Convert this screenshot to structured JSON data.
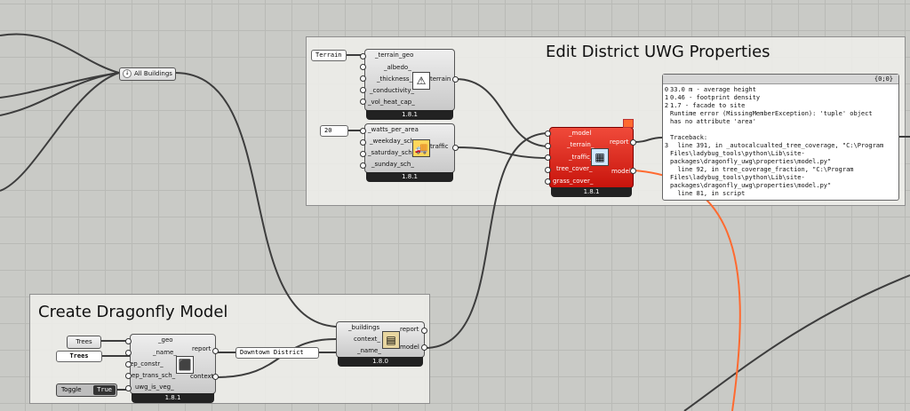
{
  "groups": {
    "uwg_title": "Edit District UWG Properties",
    "model_title": "Create Dragonfly Model"
  },
  "params": {
    "all_buildings": "All Buildings",
    "trees_param": "Trees"
  },
  "inputs": {
    "terrain_panel": "Terrain",
    "watts_panel": "20",
    "trees_panel": "Trees",
    "district_panel": "Downtown District",
    "toggle_label": "Toggle",
    "toggle_value": "True"
  },
  "terrain_comp": {
    "inputs": [
      "_terrain_geo",
      "_albedo_",
      "_thickness_",
      "_conductivity_",
      "_vol_heat_cap_"
    ],
    "output": "terrain",
    "version": "1.8.1"
  },
  "traffic_comp": {
    "inputs": [
      "_watts_per_area",
      "_weekday_sch_",
      "_saturday_sch_",
      "_sunday_sch_"
    ],
    "output": "traffic",
    "version": "1.8.1"
  },
  "uwg_comp": {
    "inputs": [
      "_model",
      "_terrain_",
      "_traffic_",
      "tree_cover_",
      "grass_cover_"
    ],
    "outputs": [
      "report",
      "model"
    ],
    "version": "1.8.1"
  },
  "building_comp": {
    "inputs": [
      "_geo",
      "_name_",
      "ep_constr_",
      "ep_trans_sch_",
      "uwg_is_veg_"
    ],
    "outputs": [
      "report",
      "context"
    ],
    "version": "1.8.1"
  },
  "model_comp": {
    "inputs": [
      "_buildings",
      "context_",
      "_name_"
    ],
    "outputs": [
      "report",
      "model"
    ],
    "version": "1.8.0"
  },
  "report_panel": {
    "header": "{0;0}",
    "rows": [
      {
        "idx": "0",
        "text": "33.0 m - average height"
      },
      {
        "idx": "1",
        "text": "0.46 - footprint density"
      },
      {
        "idx": "2",
        "text": "1.7 - facade to site"
      },
      {
        "idx": "3",
        "text": "Runtime error (MissingMemberException): 'tuple' object\nhas no attribute 'area'\n\nTraceback:\n  line 391, in _autocalcualted_tree_coverage, \"C:\\Program\nFiles\\ladybug_tools\\python\\Lib\\site-\npackages\\dragonfly_uwg\\properties\\model.py\"\n  line 92, in tree_coverage_fraction, \"C:\\Program\nFiles\\ladybug_tools\\python\\Lib\\site-\npackages\\dragonfly_uwg\\properties\\model.py\"\n  line 81, in script"
      }
    ]
  },
  "colors": {
    "canvas": "#c9cac6",
    "wire": "#3d3d3d",
    "error_component": "#d61d12",
    "error_wire": "#ff6a30"
  }
}
